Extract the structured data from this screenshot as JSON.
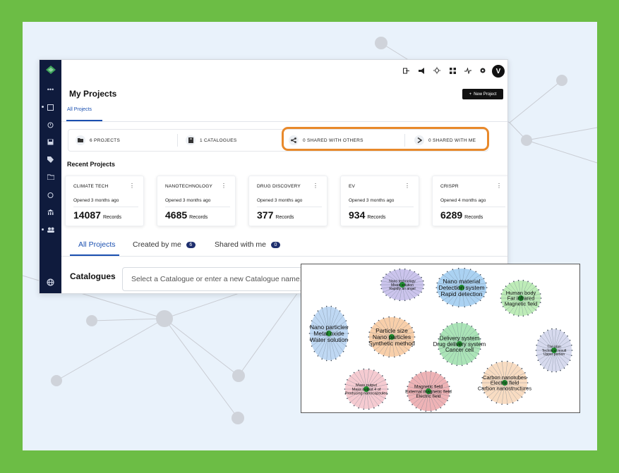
{
  "topbar": {
    "icons": [
      "logout-icon",
      "megaphone-icon",
      "sun-icon",
      "grid-icon",
      "activity-icon",
      "gear-icon"
    ],
    "avatar_letter": "V"
  },
  "sidebar": {
    "icons": [
      "more-icon",
      "folder-icon",
      "history-icon",
      "save-icon",
      "tag-icon",
      "folder-open-icon",
      "alarm-icon",
      "bank-icon",
      "users-icon",
      "globe-icon"
    ]
  },
  "header": {
    "title": "My Projects",
    "new_project_label": "New Project",
    "subtab_label": "All Projects"
  },
  "stats": {
    "projects": "6 PROJECTS",
    "catalogues": "1 CATALOGUES",
    "shared_with_others": "0 SHARED WITH OTHERS",
    "shared_with_me": "0 SHARED WITH ME"
  },
  "recent": {
    "title": "Recent Projects",
    "records_label": "Records",
    "cards": [
      {
        "name": "CLIMATE TECH",
        "opened": "Opened  3 months ago",
        "count": "14087"
      },
      {
        "name": "NANOTECHNOLOGY",
        "opened": "Opened  3 months ago",
        "count": "4685"
      },
      {
        "name": "DRUG DISCOVERY",
        "opened": "Opened  3 months ago",
        "count": "377"
      },
      {
        "name": "EV",
        "opened": "Opened  3 months ago",
        "count": "934"
      },
      {
        "name": "CRISPR",
        "opened": "Opened  4 months ago",
        "count": "6289"
      }
    ]
  },
  "tabs": {
    "all_projects": "All Projects",
    "created_by_me": "Created by me",
    "created_by_me_count": "6",
    "shared_with_me": "Shared with me",
    "shared_with_me_count": "0"
  },
  "catalogues": {
    "label": "Catalogues",
    "placeholder": "Select a Catalogue or enter a new Catalogue name..."
  },
  "clusters": [
    {
      "color": "#b9b0e6",
      "lines": [
        "Nano technology",
        "Mixed solution",
        "Rapidly an angel"
      ]
    },
    {
      "color": "#8fc3ee",
      "lines": [
        "Nano material",
        "Detection system",
        "Rapid detection"
      ]
    },
    {
      "color": "#a8e6a0",
      "lines": [
        "Human body",
        "Far infrared",
        "Magnetic field"
      ]
    },
    {
      "color": "#a9cbef",
      "lines": [
        "Nano particles",
        "Metal oxide",
        "Water solution"
      ]
    },
    {
      "color": "#f5bf8e",
      "lines": [
        "Particle size",
        "Nano particles",
        "Synthetic method"
      ]
    },
    {
      "color": "#8fdb9f",
      "lines": [
        "Delivery system",
        "Drug delivery system",
        "Cancer cell"
      ]
    },
    {
      "color": "#c9cde8",
      "lines": [
        "The plan",
        "Technical result",
        "Upper portion"
      ]
    },
    {
      "color": "#f2b9c2",
      "lines": [
        "Mass output",
        "Mass output 4 of",
        "Producing nanocapsules"
      ]
    },
    {
      "color": "#e89a9e",
      "lines": [
        "Magnetic field",
        "External magnetic field",
        "Electric field"
      ]
    },
    {
      "color": "#f5d0ae",
      "lines": [
        "Carbon nanotubes",
        "Electric field",
        "Carbon nanostructures"
      ]
    }
  ]
}
